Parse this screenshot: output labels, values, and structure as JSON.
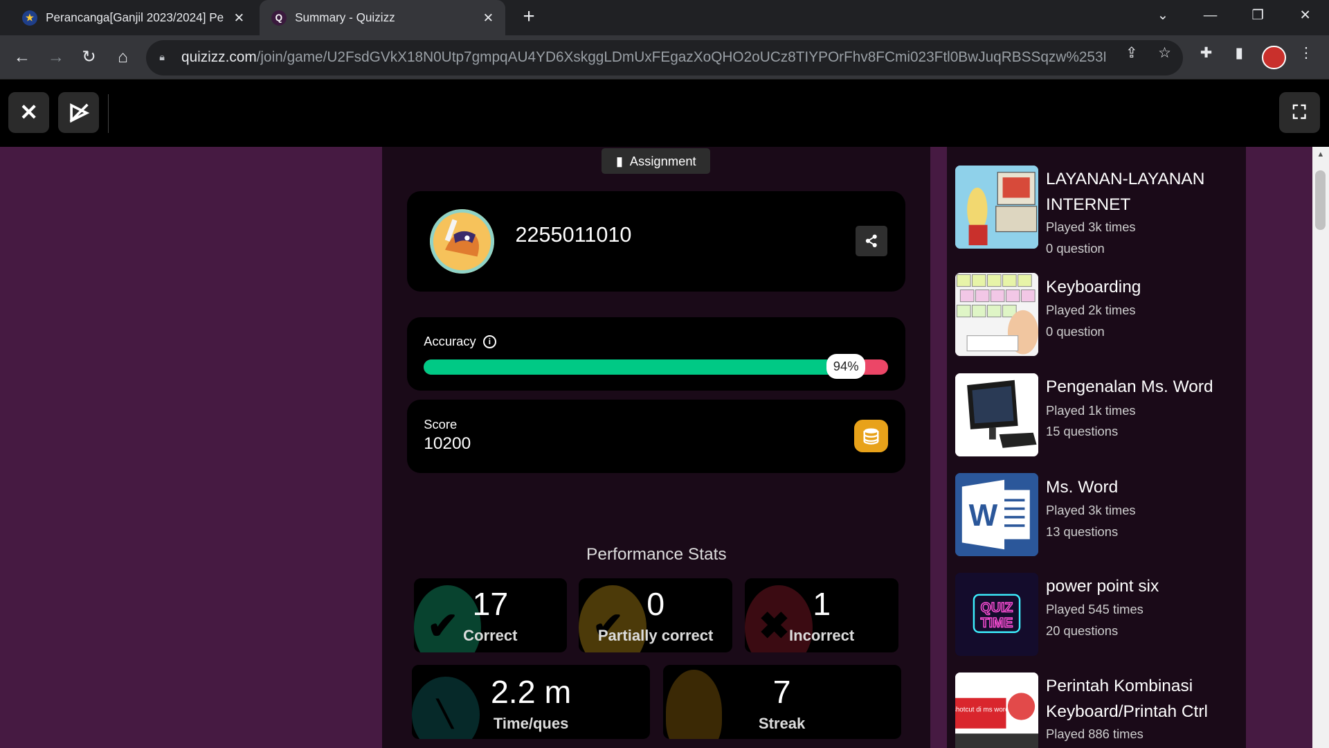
{
  "browser": {
    "tabs": [
      {
        "title": "Perancanga[Ganjil 2023/2024] Pe",
        "active": false
      },
      {
        "title": "Summary - Quizizz",
        "active": true
      }
    ],
    "url_host": "quizizz.com",
    "url_path": "/join/game/U2FsdGVkX18N0Utp7gmpqAU4YD6XskggLDmUxFEgazXoQHO2oUCz8TIYPOrFhv8FCmi023Ftl0BwJuqRBSSqzw%253D%..."
  },
  "summary": {
    "assignment_label": "Assignment",
    "username": "2255011010",
    "accuracy_label": "Accuracy",
    "accuracy_percent": 94,
    "accuracy_text": "94%",
    "score_label": "Score",
    "score_value": "10200",
    "perf_title": "Performance Stats",
    "stats": {
      "correct": {
        "value": "17",
        "label": "Correct"
      },
      "partial": {
        "value": "0",
        "label": "Partially correct"
      },
      "incorrect": {
        "value": "1",
        "label": "Incorrect"
      },
      "time": {
        "value": "2.2 m",
        "label": "Time/ques"
      },
      "streak": {
        "value": "7",
        "label": "Streak"
      }
    }
  },
  "recommendations": [
    {
      "title": "LAYANAN-LAYANAN INTERNET",
      "played": "Played 3k times",
      "questions": "0 question"
    },
    {
      "title": "Keyboarding",
      "played": "Played 2k times",
      "questions": "0 question"
    },
    {
      "title": "Pengenalan Ms. Word",
      "played": "Played 1k times",
      "questions": "15 questions"
    },
    {
      "title": "Ms. Word",
      "played": "Played 3k times",
      "questions": "13 questions"
    },
    {
      "title": "power point six",
      "played": "Played 545 times",
      "questions": "20 questions"
    },
    {
      "title": "Perintah Kombinasi Keyboard/Printah Ctrl",
      "played": "Played 886 times",
      "questions": ""
    }
  ],
  "thumb_text": {
    "quiz": "QUIZ",
    "time": "TIME",
    "word_letter": "W",
    "shortcut": "shotcut di ms word"
  },
  "colors": {
    "page_bg": "#461a42",
    "accuracy_fill": "#00c985",
    "accuracy_rest": "#ec4667",
    "coin": "#e8a21a"
  },
  "icons": [
    "close-icon",
    "share-icon",
    "info-icon",
    "coins-icon",
    "check-icon",
    "cross-icon",
    "stopwatch-icon",
    "flame-icon",
    "fullscreen-icon",
    "file-icon"
  ]
}
